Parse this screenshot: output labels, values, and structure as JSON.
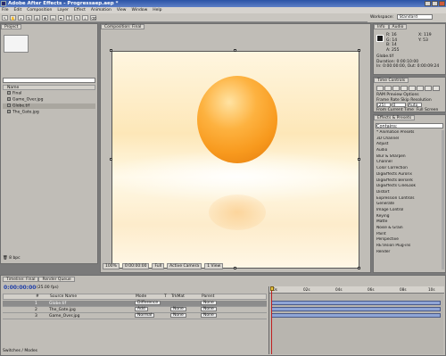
{
  "window": {
    "title": "Adobe After Effects - Progressaep.aep *"
  },
  "menu": [
    "File",
    "Edit",
    "Composition",
    "Layer",
    "Effect",
    "Animation",
    "View",
    "Window",
    "Help"
  ],
  "workspace": {
    "label": "Workspace:",
    "value": "Standard"
  },
  "project": {
    "tab": "Project",
    "column": "Name",
    "items": [
      "Final",
      "Game_Over.jpg",
      "Globe.tif",
      "The_Gate.jpg"
    ],
    "footer": "8 bpc"
  },
  "composition": {
    "tab": "Composition: Final",
    "footer": [
      "100%",
      "0:00:00:00",
      "Full",
      "Active Camera",
      "1 View"
    ]
  },
  "info": {
    "tabs": [
      "Info",
      "Audio"
    ],
    "rgb": [
      "R: 16",
      "G: 14",
      "B: 14",
      "A: 255"
    ],
    "xy": [
      "X: 119",
      "Y: 53"
    ],
    "meta": [
      "Globe.tif",
      "Duration: 0:00:10:00",
      "In: 0:00:00:00, Out: 0:00:09:24"
    ]
  },
  "time_controls": {
    "tab": "Time Controls",
    "preview": "RAM Preview Options",
    "labels": [
      "Frame Rate",
      "Skip",
      "Resolution"
    ],
    "values": [
      "(25)",
      "0",
      "Auto"
    ],
    "options": [
      "From Current Time",
      "Full Screen"
    ]
  },
  "effects": {
    "tab": "Effects & Presets",
    "search_label": "Contains:",
    "items": [
      "* Animation Presets",
      "3D Channel",
      "Adjust",
      "Audio",
      "Blur & Sharpen",
      "Channel",
      "Color Correction",
      "DigiEffects Aurorix",
      "DigiEffects Berserk",
      "DigiEffects CineLook",
      "Distort",
      "Expression Controls",
      "Generate",
      "Image Control",
      "Keying",
      "Matte",
      "Noise & Grain",
      "Paint",
      "Perspective",
      "RE:Vision Plug-ins",
      "Render"
    ]
  },
  "timeline": {
    "tabs": [
      "Timeline: Final",
      "Render Queue"
    ],
    "time": "0:00:00:00",
    "fps": "(25.00 fps)",
    "columns": [
      "#",
      "Source Name",
      "Mode",
      "T",
      "TrkMat",
      "Parent"
    ],
    "layers": [
      {
        "num": "1",
        "name": "Globe.tif",
        "mode": "Difference",
        "trkmat": "",
        "parent": "None"
      },
      {
        "num": "2",
        "name": "The_Gate.jpg",
        "mode": "Add",
        "trkmat": "None",
        "parent": "None"
      },
      {
        "num": "3",
        "name": "Game_Over.jpg",
        "mode": "Normal",
        "trkmat": "None",
        "parent": "None"
      }
    ],
    "ruler": [
      "0s",
      "02s",
      "04s",
      "06s",
      "08s",
      "10s"
    ],
    "footer": "Switches / Modes"
  }
}
